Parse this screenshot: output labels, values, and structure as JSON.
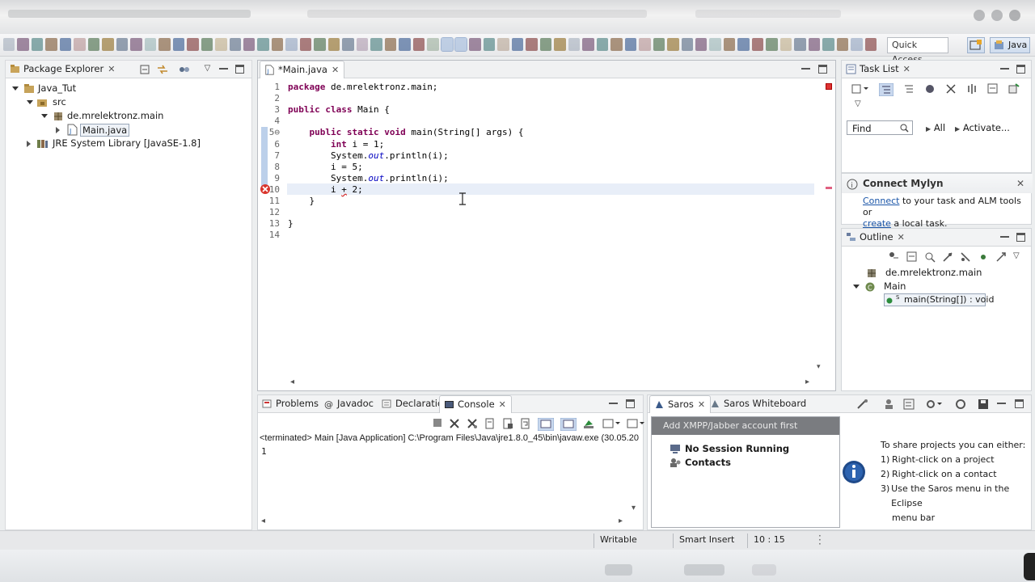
{
  "toolbar": {
    "quick_access": "Quick Access",
    "perspective_label": "Java"
  },
  "package_explorer": {
    "title": "Package Explorer",
    "tree": {
      "project": "Java_Tut",
      "src": "src",
      "package": "de.mrelektronz.main",
      "file": "Main.java",
      "library": "JRE System Library [JavaSE-1.8]"
    }
  },
  "editor": {
    "tab_title": "*Main.java",
    "lines": [
      {
        "num": "1",
        "text": "package de.mrelektronz.main;"
      },
      {
        "num": "2",
        "text": ""
      },
      {
        "num": "3",
        "text": "public class Main {"
      },
      {
        "num": "4",
        "text": ""
      },
      {
        "num": "5⊖",
        "text": "    public static void main(String[] args) {"
      },
      {
        "num": "6",
        "text": "        int i = 1;"
      },
      {
        "num": "7",
        "text": "        System.out.println(i);"
      },
      {
        "num": "8",
        "text": "        i = 5;"
      },
      {
        "num": "9",
        "text": "        System.out.println(i);"
      },
      {
        "num": "10",
        "text": "        i + 2;"
      },
      {
        "num": "11",
        "text": "    }"
      },
      {
        "num": "12",
        "text": ""
      },
      {
        "num": "13",
        "text": "}"
      },
      {
        "num": "14",
        "text": ""
      }
    ]
  },
  "task_list": {
    "title": "Task List",
    "find_placeholder": "Find",
    "all_label": "All",
    "activate_label": "Activate..."
  },
  "mylyn": {
    "title": "Connect Mylyn",
    "connect_link": "Connect",
    "connect_text": " to your task and ALM tools or",
    "create_link": "create",
    "create_text": " a local task."
  },
  "outline": {
    "title": "Outline",
    "package": "de.mrelektronz.main",
    "class": "Main",
    "method": "main(String[]) : void",
    "method_marker": "S"
  },
  "bottom_tabs": {
    "problems": "Problems",
    "javadoc": "Javadoc",
    "declaration": "Declaration",
    "console": "Console"
  },
  "console": {
    "header": "<terminated> Main [Java Application] C:\\Program Files\\Java\\jre1.8.0_45\\bin\\javaw.exe (30.05.20",
    "output": "1"
  },
  "saros": {
    "tab_saros": "Saros",
    "tab_whiteboard": "Saros Whiteboard",
    "banner": "Add XMPP/Jabber account first",
    "no_session": "No Session Running",
    "contacts": "Contacts",
    "info_title": "To share projects you can either:",
    "steps": [
      {
        "n": "1)",
        "text": "Right-click on a project"
      },
      {
        "n": "2)",
        "text": "Right-click on a contact"
      },
      {
        "n": "3)",
        "text": "Use the Saros menu in the Eclipse"
      },
      {
        "n": "",
        "text": "menu bar"
      }
    ]
  },
  "statusbar": {
    "writable": "Writable",
    "insert_mode": "Smart Insert",
    "position": "10 : 15"
  },
  "colors": {
    "keyword": "#7f0055",
    "static_field": "#0000c0",
    "error": "#d22020",
    "link": "#1a55a8"
  }
}
